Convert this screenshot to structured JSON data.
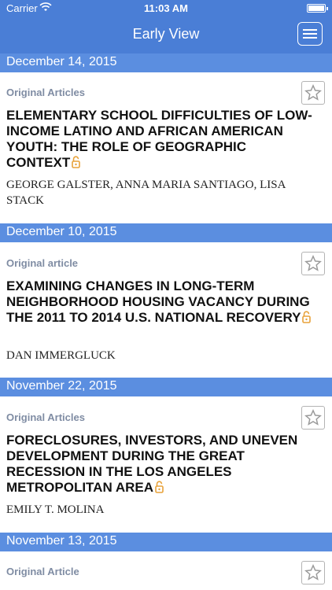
{
  "status_bar": {
    "carrier": "Carrier",
    "time": "11:03 AM",
    "battery_level": 1.0
  },
  "nav": {
    "title": "Early View",
    "menu_icon": "hamburger-menu-icon"
  },
  "colors": {
    "nav_bar": "#4a7ed6",
    "section_header": "#5b8ee0",
    "lock_icon": "#e8a23a",
    "category_text": "#7f8ca3"
  },
  "sections": [
    {
      "date": "December 14, 2015",
      "article": {
        "category": "Original Articles",
        "title": "ELEMENTARY SCHOOL DIFFICULTIES OF LOW-INCOME LATINO AND AFRICAN AMERICAN YOUTH: THE ROLE OF GEOGRAPHIC CONTEXT",
        "authors": "GEORGE GALSTER, ANNA MARIA SANTIAGO, LISA STACK",
        "open_access": true
      }
    },
    {
      "date": "December 10, 2015",
      "article": {
        "category": "Original article",
        "title": "EXAMINING CHANGES IN LONG-TERM NEIGHBORHOOD HOUSING VACANCY DURING THE 2011 TO 2014 U.S. NATIONAL RECOVERY",
        "authors": "DAN IMMERGLUCK",
        "open_access": true
      }
    },
    {
      "date": "November 22, 2015",
      "article": {
        "category": "Original Articles",
        "title": "FORECLOSURES, INVESTORS, AND UNEVEN DEVELOPMENT DURING THE GREAT RECESSION IN THE LOS ANGELES METROPOLITAN AREA",
        "authors": "EMILY T. MOLINA",
        "open_access": true
      }
    },
    {
      "date": "November 13, 2015",
      "article": {
        "category": "Original Article",
        "title": "",
        "authors": ""
      }
    }
  ]
}
